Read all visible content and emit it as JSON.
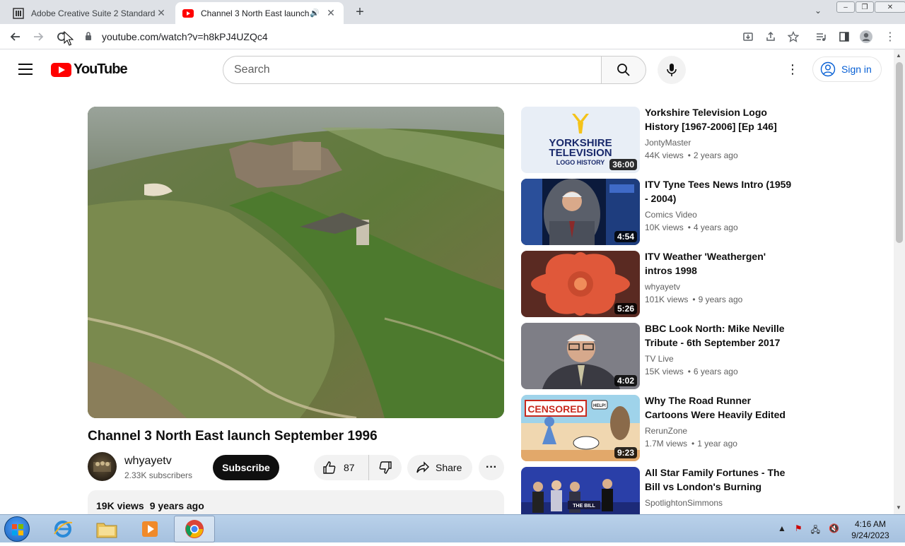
{
  "browser": {
    "tabs": [
      {
        "title": "Adobe Creative Suite 2 Standard",
        "active": false
      },
      {
        "title": "Channel 3 North East launch",
        "active": true
      }
    ],
    "url": "youtube.com/watch?v=h8kPJ4UZQc4"
  },
  "masthead": {
    "logo_text": "YouTube",
    "search_placeholder": "Search",
    "signin_label": "Sign in"
  },
  "video": {
    "title": "Channel 3 North East launch September 1996",
    "channel": "whyayetv",
    "subscribers": "2.33K subscribers",
    "subscribe_label": "Subscribe",
    "likes": "87",
    "share_label": "Share",
    "views": "19K views",
    "age": "9 years ago"
  },
  "recommendations": [
    {
      "title": "Yorkshire Television Logo History [1967-2006] [Ep 146]",
      "channel": "JontyMaster",
      "views": "44K views",
      "age": "2 years ago",
      "duration": "36:00",
      "thumb_text": [
        "YORKSHIRE",
        "TELEVISION",
        "LOGO HISTORY"
      ]
    },
    {
      "title": "ITV Tyne Tees News Intro (1959 - 2004)",
      "channel": "Comics Video",
      "views": "10K views",
      "age": "4 years ago",
      "duration": "4:54"
    },
    {
      "title": "ITV Weather 'Weathergen' intros 1998",
      "channel": "whyayetv",
      "views": "101K views",
      "age": "9 years ago",
      "duration": "5:26"
    },
    {
      "title": "BBC Look North: Mike Neville Tribute - 6th September 2017",
      "channel": "TV Live",
      "views": "15K views",
      "age": "6 years ago",
      "duration": "4:02"
    },
    {
      "title": "Why The Road Runner Cartoons Were Heavily Edited in the...",
      "channel": "RerunZone",
      "views": "1.7M views",
      "age": "1 year ago",
      "duration": "9:23",
      "thumb_text": [
        "CENSORED",
        "HELP!"
      ]
    },
    {
      "title": "All Star Family Fortunes - The Bill vs London's Burning",
      "channel": "SpotlightonSimmons",
      "views": "",
      "age": "",
      "duration": "",
      "thumb_text": [
        "THE BILL"
      ]
    }
  ],
  "taskbar": {
    "time": "4:16 AM",
    "date": "9/24/2023"
  },
  "colors": {
    "yt_red": "#ff0000",
    "link_blue": "#065fd4",
    "chrome_tab_strip": "#dee1e6"
  }
}
